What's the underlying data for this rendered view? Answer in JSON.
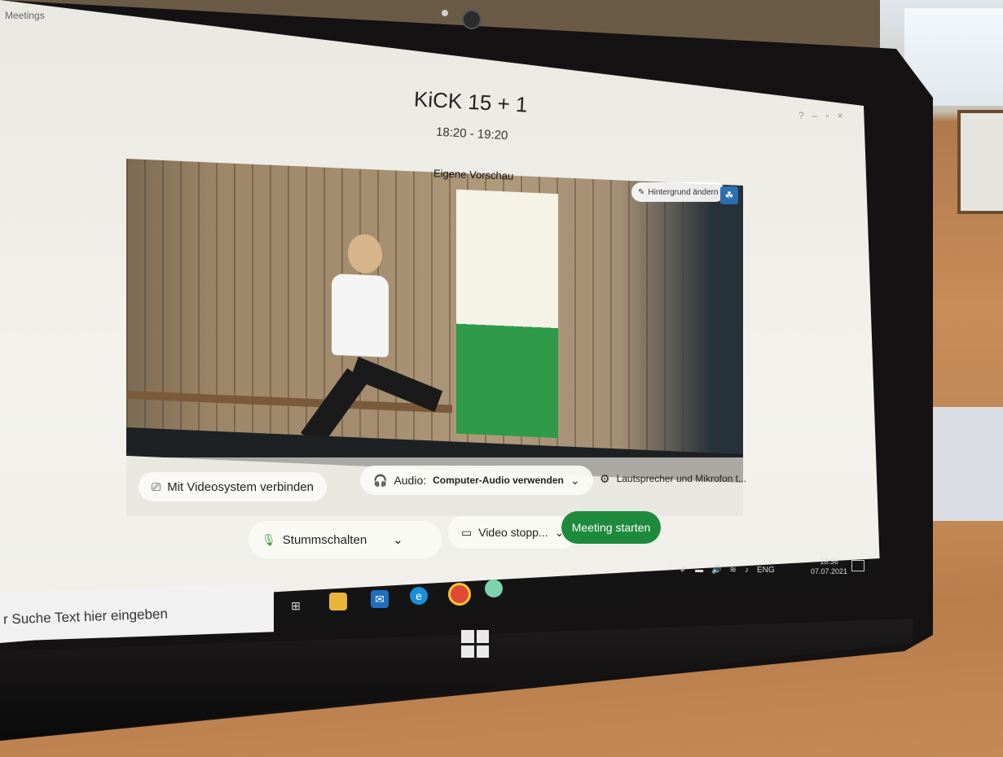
{
  "app_label": "Meetings",
  "meeting": {
    "title": "KiCK 15 + 1",
    "time": "18:20 - 19:20"
  },
  "preview": {
    "label": "Eigene Vorschau",
    "background_button": "Hintergrund ändern"
  },
  "controls": {
    "video_system": "Mit Videosystem verbinden",
    "audio_prefix": "Audio:",
    "audio_value": "Computer-Audio verwenden",
    "speaker_mic": "Lautsprecher und Mikrofon t...",
    "mute": "Stummschalten",
    "video_stop": "Video stopp...",
    "start": "Meeting starten"
  },
  "taskbar": {
    "search_placeholder": "r Suche Text hier eingeben",
    "language": "ENG",
    "clock_time": "18:36",
    "clock_date": "07.07.2021"
  },
  "colors": {
    "start_button": "#1e8a3c",
    "mic_icon": "#3a9a3a",
    "bg_icon_button": "#2a6fb0"
  }
}
